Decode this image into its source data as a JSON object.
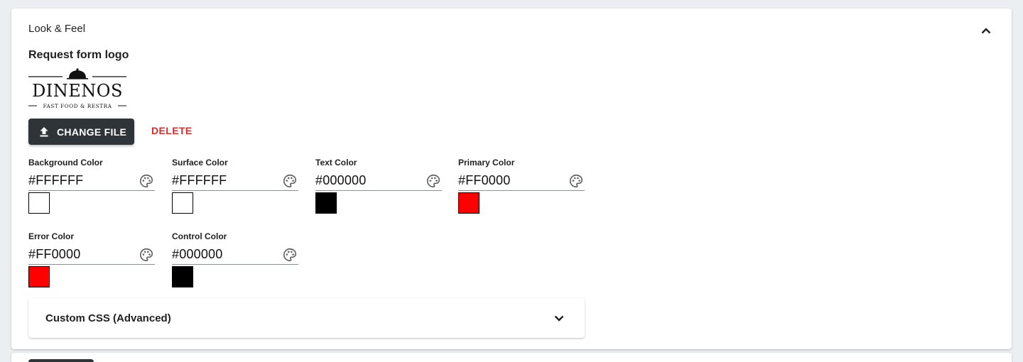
{
  "section": {
    "title": "Look & Feel",
    "collapse_icon": "chevron-up-icon"
  },
  "logo": {
    "heading": "Request form logo",
    "image": {
      "brand": "DINENOS",
      "tagline": "FAST FOOD & RESTRA"
    },
    "change_button_label": "CHANGE FILE",
    "change_button_icon": "upload-icon",
    "delete_button_label": "DELETE"
  },
  "colors": [
    {
      "label": "Background Color",
      "value": "#FFFFFF",
      "swatch": "#ffffff"
    },
    {
      "label": "Surface Color",
      "value": "#FFFFFF",
      "swatch": "#ffffff"
    },
    {
      "label": "Text Color",
      "value": "#000000",
      "swatch": "#000000"
    },
    {
      "label": "Primary Color",
      "value": "#FF0000",
      "swatch": "#ff0000"
    },
    {
      "label": "Error Color",
      "value": "#FF0000",
      "swatch": "#ff0000"
    },
    {
      "label": "Control Color",
      "value": "#000000",
      "swatch": "#000000"
    }
  ],
  "custom_css": {
    "title": "Custom CSS (Advanced)",
    "expand_icon": "chevron-down-icon"
  },
  "theme": {
    "button_dark": "#2f3439",
    "danger": "#d32f2f",
    "page_background": "#eceff1"
  }
}
